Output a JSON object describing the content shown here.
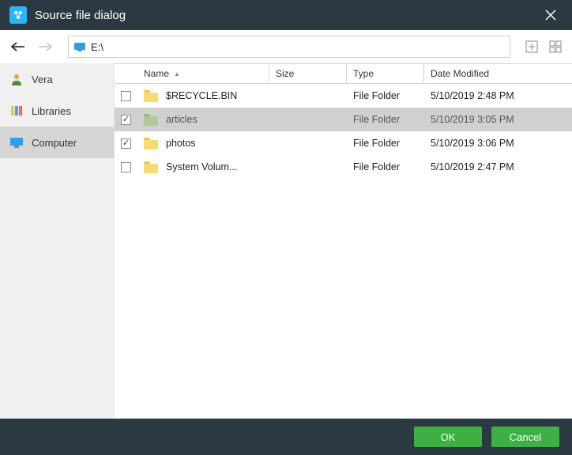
{
  "title": "Source file dialog",
  "address": "E:\\",
  "sidebar": [
    {
      "label": "Vera",
      "active": false,
      "icon": "user"
    },
    {
      "label": "Libraries",
      "active": false,
      "icon": "libs"
    },
    {
      "label": "Computer",
      "active": true,
      "icon": "monitor"
    }
  ],
  "columns": {
    "name": "Name",
    "size": "Size",
    "type": "Type",
    "date": "Date Modified"
  },
  "rows": [
    {
      "checked": false,
      "selected": false,
      "color": "yellow",
      "name": "$RECYCLE.BIN",
      "size": "",
      "type": "File Folder",
      "date": "5/10/2019 2:48 PM"
    },
    {
      "checked": true,
      "selected": true,
      "color": "green",
      "name": "articles",
      "size": "",
      "type": "File Folder",
      "date": "5/10/2019 3:05 PM"
    },
    {
      "checked": true,
      "selected": false,
      "color": "yellow",
      "name": "photos",
      "size": "",
      "type": "File Folder",
      "date": "5/10/2019 3:06 PM"
    },
    {
      "checked": false,
      "selected": false,
      "color": "yellow",
      "name": "System Volum...",
      "size": "",
      "type": "File Folder",
      "date": "5/10/2019 2:47 PM"
    }
  ],
  "buttons": {
    "ok": "OK",
    "cancel": "Cancel"
  }
}
